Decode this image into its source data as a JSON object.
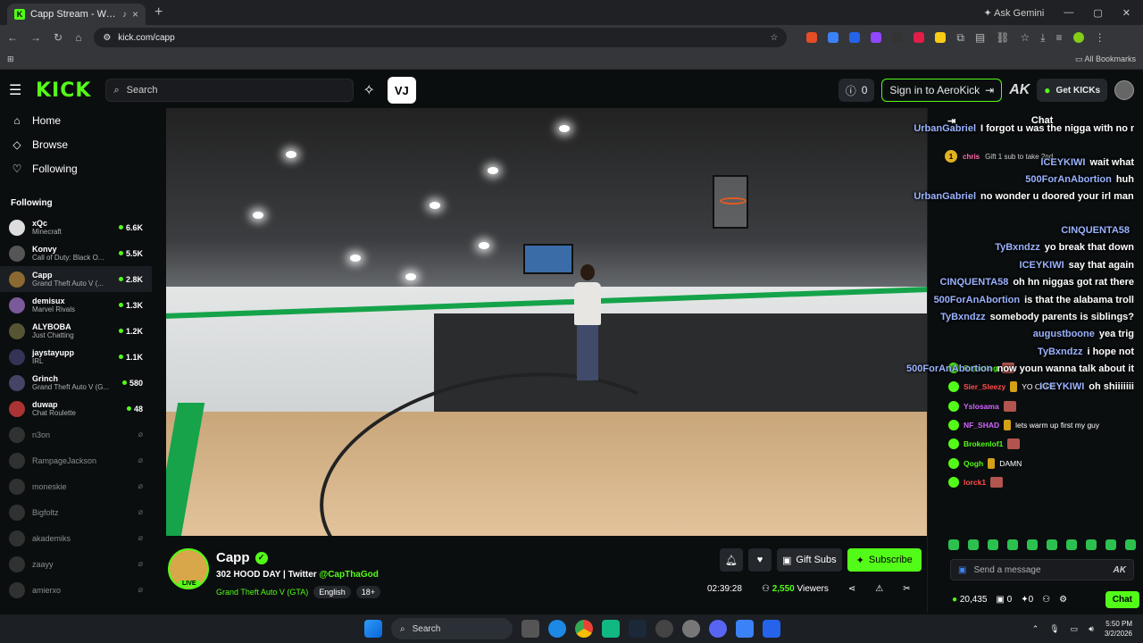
{
  "browser": {
    "tab_title": "Capp Stream - Watch Live ...",
    "url": "kick.com/capp",
    "gemini": "Ask Gemini",
    "all_bookmarks": "All Bookmarks"
  },
  "header": {
    "logo": "KICK",
    "search_placeholder": "Search",
    "v_button": "VJ",
    "notif_count": "0",
    "signin": "Sign in to AeroKick",
    "ak": "AK",
    "get_kicks": "Get KICKs"
  },
  "sidebar": {
    "nav": [
      {
        "label": "Home",
        "icon": "home-icon"
      },
      {
        "label": "Browse",
        "icon": "browse-icon"
      },
      {
        "label": "Following",
        "icon": "heart-icon"
      }
    ],
    "following_header": "Following",
    "channels": [
      {
        "name": "xQc",
        "category": "Minecraft",
        "viewers": "6.6K",
        "live": true
      },
      {
        "name": "Konvy",
        "category": "Call of Duty: Black O...",
        "viewers": "5.5K",
        "live": true
      },
      {
        "name": "Capp",
        "category": "Grand Theft Auto V (...",
        "viewers": "2.8K",
        "live": true
      },
      {
        "name": "demisux",
        "category": "Marvel Rivals",
        "viewers": "1.3K",
        "live": true
      },
      {
        "name": "ALYBOBA",
        "category": "Just Chatting",
        "viewers": "1.2K",
        "live": true
      },
      {
        "name": "jaystayupp",
        "category": "IRL",
        "viewers": "1.1K",
        "live": true
      },
      {
        "name": "Grinch",
        "category": "Grand Theft Auto V (G...",
        "viewers": "580",
        "live": true
      },
      {
        "name": "duwap",
        "category": "Chat Roulette",
        "viewers": "48",
        "live": true
      },
      {
        "name": "n3on",
        "category": "",
        "viewers": "",
        "live": false
      },
      {
        "name": "RampageJackson",
        "category": "",
        "viewers": "",
        "live": false
      },
      {
        "name": "moneskie",
        "category": "",
        "viewers": "",
        "live": false
      },
      {
        "name": "Bigfoltz",
        "category": "",
        "viewers": "",
        "live": false
      },
      {
        "name": "akademiks",
        "category": "",
        "viewers": "",
        "live": false
      },
      {
        "name": "zaayy",
        "category": "",
        "viewers": "",
        "live": false
      },
      {
        "name": "amierxo",
        "category": "",
        "viewers": "",
        "live": false
      }
    ]
  },
  "stream": {
    "streamer": "Capp",
    "live_badge": "LIVE",
    "title_prefix": "302 HOOD DAY | Twitter",
    "twitter": "@CapThaGod",
    "category": "Grand Theft Auto V (GTA)",
    "tag_language": "English",
    "tag_age": "18+",
    "gift_subs": "Gift Subs",
    "subscribe": "Subscribe",
    "uptime": "02:39:28",
    "viewers": "2,550",
    "viewers_label": "Viewers"
  },
  "chat": {
    "title": "Chat",
    "pinned_num": "1",
    "pinned_user": "chris",
    "pinned_text": "Gift 1 sub to take 2nd",
    "overlay": [
      {
        "user": "UrbanGabriel",
        "text": "I forgot u was the nigga with no morals"
      },
      {
        "user": "ICEYKIWI",
        "text": "wait what"
      },
      {
        "user": "500ForAnAbortion",
        "text": "huh"
      },
      {
        "user": "UrbanGabriel",
        "text": "no wonder u doored your irl mans"
      },
      {
        "user": "CINQUENTA58",
        "text": ""
      },
      {
        "user": "TyBxndzz",
        "text": "yo break that down"
      },
      {
        "user": "ICEYKIWI",
        "text": "say that again"
      },
      {
        "user": "CINQUENTA58",
        "text": "oh hn niggas got rat there"
      },
      {
        "user": "500ForAnAbortion",
        "text": "is that the alabama troll"
      },
      {
        "user": "TyBxndzz",
        "text": "somebody parents is siblings?"
      },
      {
        "user": "augustboone",
        "text": "yea trig"
      },
      {
        "user": "TyBxndzz",
        "text": "i hope not"
      },
      {
        "user": "500ForAnAbortion",
        "text": "now youn wanna talk about it"
      },
      {
        "user": "ICEYKIWI",
        "text": "oh shiiiiiii"
      }
    ],
    "messages": [
      {
        "user": "Rejecting",
        "text": "",
        "color": "#53fc18"
      },
      {
        "user": "Sier_Sleezy",
        "text": "YO CAPP",
        "color": "#ff4d4d"
      },
      {
        "user": "Yslosama",
        "text": "",
        "color": "#d264ff"
      },
      {
        "user": "NF_SHAD",
        "text": "lets warm up first my guy",
        "color": "#d264ff"
      },
      {
        "user": "Brokenlof1",
        "text": "",
        "color": "#53fc18"
      },
      {
        "user": "Qogh",
        "text": "DAMN",
        "color": "#53fc18"
      },
      {
        "user": "lorck1",
        "text": "",
        "color": "#ff4d4d"
      }
    ],
    "input_placeholder": "Send a message",
    "input_ak": "AK",
    "points": "20,435",
    "gift_count": "0",
    "kick_count": "0",
    "chat_button": "Chat"
  },
  "taskbar": {
    "search": "Search",
    "time": "5:50 PM",
    "date": "3/2/2026"
  }
}
